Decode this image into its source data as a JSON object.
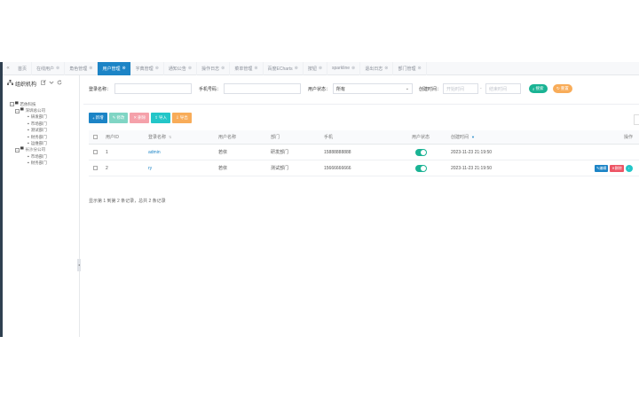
{
  "tabs": {
    "nav_left": "«",
    "items": [
      {
        "label": "首页",
        "active": false,
        "closable": false
      },
      {
        "label": "在线用户",
        "active": false,
        "closable": true
      },
      {
        "label": "角色管理",
        "active": false,
        "closable": true
      },
      {
        "label": "用户管理",
        "active": true,
        "closable": true
      },
      {
        "label": "字典管理",
        "active": false,
        "closable": true
      },
      {
        "label": "通知公告",
        "active": false,
        "closable": true
      },
      {
        "label": "操作日志",
        "active": false,
        "closable": true
      },
      {
        "label": "菜单管理",
        "active": false,
        "closable": true
      },
      {
        "label": "百度ECharts",
        "active": false,
        "closable": true
      },
      {
        "label": "按钮",
        "active": false,
        "closable": true
      },
      {
        "label": "sparkline",
        "active": false,
        "closable": true
      },
      {
        "label": "退出日志",
        "active": false,
        "closable": true
      },
      {
        "label": "部门管理",
        "active": false,
        "closable": true
      }
    ],
    "close_glyph": "⊗"
  },
  "tree": {
    "title": "组织机构",
    "nodes": [
      {
        "label": "若依科技",
        "level": 0,
        "type": "folder",
        "expander": "−"
      },
      {
        "label": "深圳总公司",
        "level": 1,
        "type": "folder",
        "expander": "−"
      },
      {
        "label": "研发部门",
        "level": 2,
        "type": "file"
      },
      {
        "label": "市场部门",
        "level": 2,
        "type": "file"
      },
      {
        "label": "测试部门",
        "level": 2,
        "type": "file"
      },
      {
        "label": "财务部门",
        "level": 2,
        "type": "file"
      },
      {
        "label": "运维部门",
        "level": 2,
        "type": "file"
      },
      {
        "label": "长沙分公司",
        "level": 1,
        "type": "folder",
        "expander": "−"
      },
      {
        "label": "市场部门",
        "level": 2,
        "type": "file"
      },
      {
        "label": "财务部门",
        "level": 2,
        "type": "file"
      }
    ]
  },
  "search": {
    "login_name_label": "登录名称：",
    "login_name_value": "",
    "phone_label": "手机号码：",
    "phone_value": "",
    "status_label": "用户状态：",
    "status_value": "所有",
    "created_label": "创建时间：",
    "start_placeholder": "开始时间",
    "range_sep": "-",
    "end_placeholder": "结束时间",
    "search_button": "搜索",
    "reset_button": "重置"
  },
  "toolbar": {
    "add": "新增",
    "edit": "修改",
    "delete": "删除",
    "import": "导入",
    "export": "导出"
  },
  "table": {
    "columns": [
      "用户ID",
      "登录名称",
      "用户名称",
      "部门",
      "手机",
      "用户状态",
      "创建时间",
      "操作"
    ],
    "rows": [
      {
        "id": "1",
        "login": "admin",
        "name": "若依",
        "dept": "研发部门",
        "phone": "15888888888",
        "status_on": true,
        "created": "2023-11-23 21:19:50"
      },
      {
        "id": "2",
        "login": "ry",
        "name": "若依",
        "dept": "测试部门",
        "phone": "15666666666",
        "status_on": true,
        "created": "2023-11-23 21:19:50"
      }
    ],
    "action_edit": "编辑",
    "action_delete": "删除"
  },
  "pager": {
    "text": "显示第 1 到第 2 条记录，总共 2 条记录"
  },
  "colors": {
    "primary": "#1c84c6",
    "success": "#1ab394",
    "info": "#23c6c8",
    "danger": "#ed5565",
    "warning": "#f8ac59",
    "accent_pink": "#f48fb1",
    "teal_light": "#7fd6c8",
    "sidebar": "#2f4050"
  }
}
